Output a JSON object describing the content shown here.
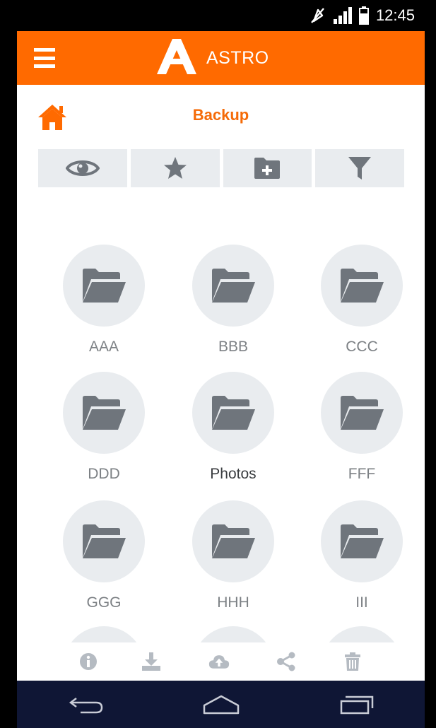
{
  "status_bar": {
    "time": "12:45"
  },
  "app_bar": {
    "title": "ASTRO"
  },
  "header": {
    "title": "Backup"
  },
  "toolbar": {
    "buttons": [
      {
        "icon": "eye-icon"
      },
      {
        "icon": "star-icon"
      },
      {
        "icon": "new-folder-icon"
      },
      {
        "icon": "filter-icon"
      }
    ]
  },
  "folders": [
    {
      "name": "AAA"
    },
    {
      "name": "BBB"
    },
    {
      "name": "CCC"
    },
    {
      "name": "DDD"
    },
    {
      "name": "Photos",
      "selected": true
    },
    {
      "name": "FFF"
    },
    {
      "name": "GGG"
    },
    {
      "name": "HHH"
    },
    {
      "name": "III"
    }
  ],
  "bottom_actions": [
    {
      "icon": "info-icon"
    },
    {
      "icon": "download-icon"
    },
    {
      "icon": "cloud-upload-icon"
    },
    {
      "icon": "share-icon"
    },
    {
      "icon": "trash-icon"
    }
  ],
  "colors": {
    "accent": "#FF6A00",
    "title_orange": "#F56B08",
    "tile_bg": "#E9ECEF",
    "icon_gray": "#6F757C",
    "action_gray": "#B5BBC2",
    "nav_bg": "#0F1635"
  }
}
